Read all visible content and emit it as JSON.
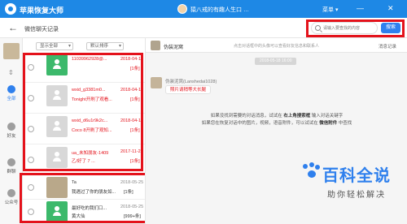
{
  "titlebar": {
    "app_title": "苹果恢复大师",
    "user": "猿八戒的有趣人生口 …",
    "menu_label": "菜单 ▾",
    "minimize": "—",
    "close": "✕"
  },
  "toolbar": {
    "back_icon": "←",
    "title": "微信聊天记录",
    "search_placeholder": "请输入要查找的内容",
    "search_button": "搜索"
  },
  "sidebar": {
    "arrow": "⇕",
    "items": [
      {
        "label": "全部",
        "active": true
      },
      {
        "label": "好友",
        "active": false
      },
      {
        "label": "群聊",
        "active": false
      },
      {
        "label": "公众号",
        "active": false
      }
    ]
  },
  "filters": {
    "show_all": "显示全部",
    "default_sort": "默认排序"
  },
  "chats": [
    {
      "name": "11039962928@...",
      "date": "2018-04-17",
      "preview": "",
      "count": "[1条]",
      "avatar": "green",
      "highlight": true
    },
    {
      "name": "wxid_g3381m0...",
      "date": "2018-04-17",
      "preview": "Tonight开刷了观看...",
      "count": "[1条]",
      "avatar": "gray",
      "highlight": true
    },
    {
      "name": "wxid_d6u1r9k2c...",
      "date": "2018-04-17",
      "preview": "Coco 8开刷了观知...",
      "count": "[1条]",
      "avatar": "gray",
      "highlight": true
    },
    {
      "name": "ua_未知朋友-1409",
      "date": "2017-11-22",
      "preview": "乙/好了 7 ...",
      "count": "[1条]",
      "avatar": "gray",
      "highlight": true
    },
    {
      "name": "Ta",
      "date": "2018-05-25",
      "preview": "我遇过了你的朋友如...",
      "count": "[1条]",
      "avatar": "photo",
      "highlight": false
    },
    {
      "name": "最好吃的我们口...",
      "date": "2018-05-25",
      "preview": "黄大仙",
      "count": "[999+条]",
      "avatar": "green",
      "highlight": false
    }
  ],
  "message_panel": {
    "group_name": "伪装泥窝",
    "header_hint": "点击对话框中的头像可以查看好友信息和联系人",
    "record_count": "消息记录",
    "date_pill": "2018-05-18 16:00",
    "sender": "伪装泥窝(Lanshedai1028)",
    "bubble_text": "照片请稍等大长腿",
    "note1_pre": "如果没找到需要的对话消息，试试在 ",
    "note1_bold": "右上角搜索框",
    "note1_post": " 输入对话关键字",
    "note2_pre": "如果您在恢复对话中的图片，视频，语音附件，可以试试在 ",
    "note2_bold": "微信附件",
    "note2_post": " 中查找"
  },
  "watermark": {
    "title": "百科全说",
    "subtitle": "助你轻松解决"
  },
  "colors": {
    "accent": "#1e88e5",
    "highlight_frame": "#e4121b",
    "watermark": "#2f80ed"
  }
}
